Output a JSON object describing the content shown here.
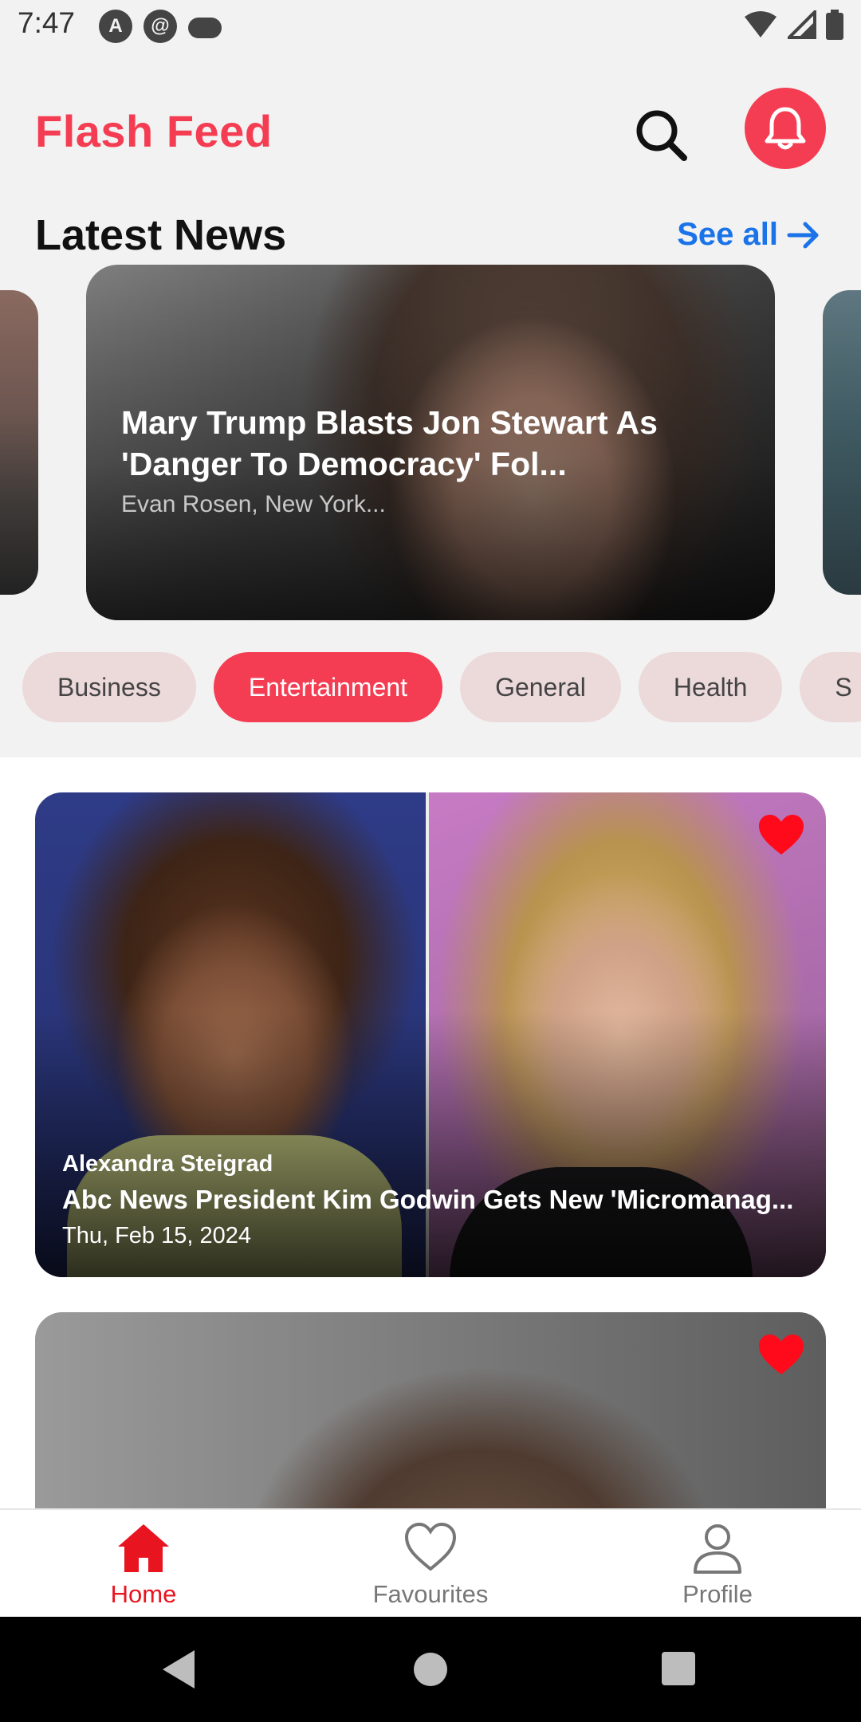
{
  "status_bar": {
    "time": "7:47"
  },
  "header": {
    "title": "Flash Feed"
  },
  "latest": {
    "title": "Latest News",
    "see_all": "See all",
    "featured": {
      "title": "Mary Trump Blasts Jon Stewart As 'Danger To Democracy' Fol...",
      "author": "Evan Rosen, New York..."
    }
  },
  "categories": [
    "Business",
    "Entertainment",
    "General",
    "Health",
    "S"
  ],
  "active_category": "Entertainment",
  "feed": [
    {
      "author": "Alexandra Steigrad",
      "title": "Abc News President Kim Godwin Gets New 'Micromanag...",
      "date": "Thu, Feb 15, 2024",
      "favourite": true
    },
    {
      "favourite": true
    }
  ],
  "nav": {
    "home": "Home",
    "favourites": "Favourites",
    "profile": "Profile"
  },
  "colors": {
    "accent": "#f43d52",
    "link": "#1a73e8",
    "heart": "#ff0a1a"
  }
}
